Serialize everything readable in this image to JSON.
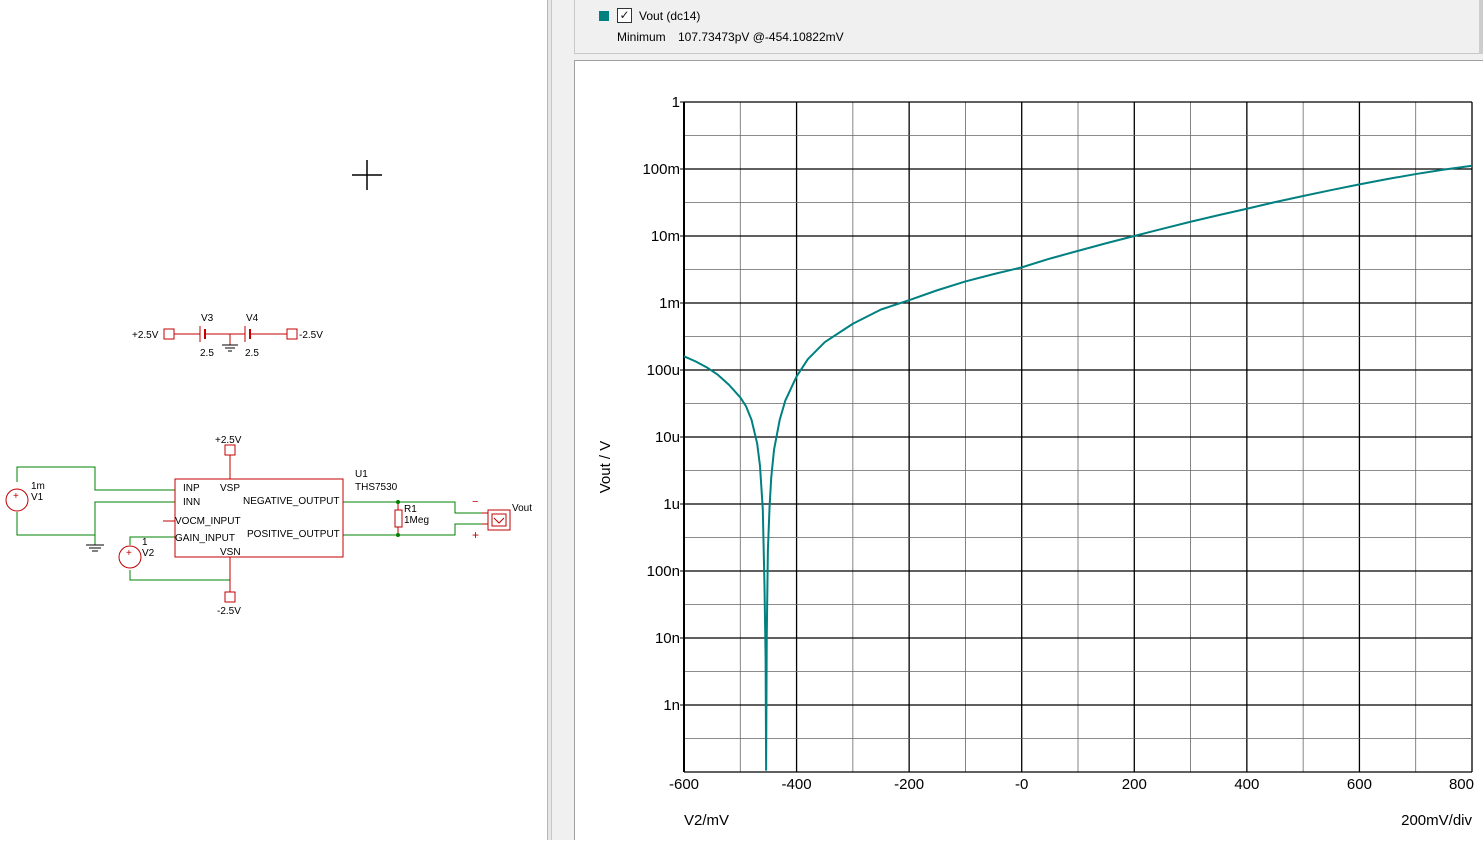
{
  "schematic": {
    "supplies": {
      "pos_label": "+2.5V",
      "neg_label": "-2.5V",
      "v3_name": "V3",
      "v3_value": "2.5",
      "v4_name": "V4",
      "v4_value": "2.5"
    },
    "v1": {
      "name": "V1",
      "value": "1m"
    },
    "v2": {
      "name": "V2",
      "value": "1"
    },
    "u1": {
      "ref": "U1",
      "part": "THS7530",
      "pins": [
        "INP",
        "INN",
        "VOCM_INPUT",
        "GAIN_INPUT",
        "VSP",
        "VSN",
        "NEGATIVE_OUTPUT",
        "POSITIVE_OUTPUT"
      ],
      "vsp_supply": "+2.5V",
      "vsn_supply": "-2.5V"
    },
    "r1": {
      "name": "R1",
      "value": "1Meg"
    },
    "probe": {
      "label": "Vout",
      "minus": "−",
      "plus": "+"
    }
  },
  "legend": {
    "checked": "✓",
    "trace_name": "Vout (dc14)",
    "minimum_label": "Minimum",
    "minimum_value": "107.73473pV @-454.10822mV",
    "trace_color": "#008080"
  },
  "chart_data": {
    "type": "line",
    "ylabel": "Vout / V",
    "xlabel": "V2/mV",
    "x_scale_label": "200mV/div",
    "xlim": [
      -600,
      800
    ],
    "ylim": [
      1e-10,
      1
    ],
    "yscale": "log",
    "grid": true,
    "x_ticks": [
      "-600",
      "-400",
      "-200",
      "-0",
      "200",
      "400",
      "600",
      "800"
    ],
    "y_ticks": [
      "1",
      "100m",
      "10m",
      "1m",
      "100u",
      "10u",
      "1u",
      "100n",
      "10n",
      "1n"
    ],
    "series": [
      {
        "color": "#008080",
        "x": [
          -600,
          -580,
          -560,
          -540,
          -520,
          -500,
          -490,
          -480,
          -470,
          -465,
          -460,
          -457,
          -455,
          -454.1,
          -453,
          -451,
          -448,
          -445,
          -440,
          -430,
          -420,
          -400,
          -380,
          -350,
          -300,
          -250,
          -200,
          -150,
          -100,
          -50,
          0,
          50,
          100,
          150,
          200,
          250,
          300,
          350,
          400,
          450,
          500,
          550,
          600,
          650,
          700,
          750,
          800
        ],
        "y": [
          0.00016,
          0.000135,
          0.00011,
          8.5e-05,
          6e-05,
          3.9e-05,
          2.9e-05,
          1.8e-05,
          8e-06,
          3.7e-06,
          8.3e-07,
          6e-08,
          5e-09,
          1.0775e-10,
          1e-08,
          2e-07,
          9e-07,
          2.5e-06,
          6.5e-06,
          1.8e-05,
          3.5e-05,
          8e-05,
          0.000145,
          0.00026,
          0.00049,
          0.0008,
          0.0011,
          0.00155,
          0.0021,
          0.0027,
          0.0034,
          0.0046,
          0.006,
          0.0078,
          0.01,
          0.0128,
          0.0163,
          0.0205,
          0.0255,
          0.032,
          0.0395,
          0.0485,
          0.059,
          0.071,
          0.084,
          0.098,
          0.112
        ]
      }
    ]
  }
}
